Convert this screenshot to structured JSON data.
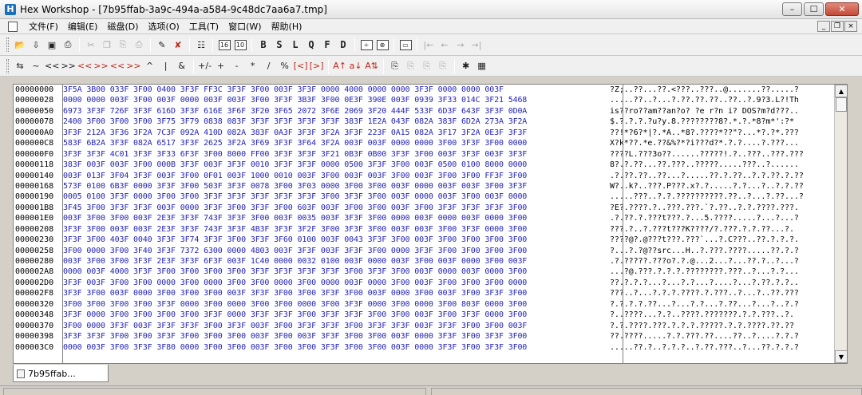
{
  "window": {
    "title": "Hex Workshop - [7b95ffab-3a9c-494a-a584-9c48dc7aa6a7.tmp]",
    "app_icon": "H",
    "min_label": "–",
    "max_label": "☐",
    "close_label": "✕"
  },
  "menubar": {
    "items": [
      "文件(F)",
      "编辑(E)",
      "磁盘(D)",
      "选项(O)",
      "工具(T)",
      "窗口(W)",
      "帮助(H)"
    ],
    "mdi_min": "_",
    "mdi_restore": "❐",
    "mdi_close": "×"
  },
  "toolbar1": {
    "open": "📂",
    "save_all": "⇩",
    "save": "▣",
    "print": "⎙",
    "cut": "✂",
    "copy": "❐",
    "paste": "⎘",
    "paste_special": "⎙",
    "find": "✎",
    "replace": "✘",
    "properties": "☷",
    "cols_16": "16",
    "cols_10": "10",
    "b_label": "B",
    "s_label": "S",
    "l_label": "L",
    "q_label": "Q",
    "f_label": "F",
    "d_label": "D",
    "calc": "÷",
    "bookmark": "⊕",
    "window": "▭",
    "nav_first": "|←",
    "nav_prev": "←",
    "nav_next": "→",
    "nav_last": "→|"
  },
  "toolbar2": {
    "items": [
      "⇆",
      "~",
      "<<",
      ">>",
      "<<",
      ">>",
      "<<",
      ">>",
      "^",
      "|",
      "&",
      "+/-",
      "+",
      "-",
      "*",
      "/",
      "%",
      "[<]",
      "[>]",
      "A↑",
      "a↓",
      "A⇅",
      "⎘",
      "⎘",
      "⎘",
      "⎘",
      "✱",
      "▦"
    ]
  },
  "editor": {
    "rows": [
      {
        "offset": "00000000",
        "hex": "3F5A 3B00 033F 3F00 0400 3F3F FF3C 3F3F 3F00 003F 3F3F 0000 4000 0000 0000 3F3F 0000 0000 003F",
        "text": "?Z;..??...??.<???..???..@.......??.....?"
      },
      {
        "offset": "00000028",
        "hex": "0000 0000 003F 3F00 003F 0000 003F 003F 3F00 3F3F 3B3F 3F00 0E3F 390E 003F 0939 3F33 014C 3F21 5468",
        "text": ".....??..?...?.??.??.??..??..?.9?3.L?!Th"
      },
      {
        "offset": "00000050",
        "hex": "6973 3F3F 726F 3F3F 616D 3F3F 616E 3F6F 3F20 3F65 2072 3F6E 2069 3F20 444F 533F 6D3F 643F 3F3F 0D0A",
        "text": "is??ro??am??an?o? ?e r?n i? DOS?m?d???.."
      },
      {
        "offset": "00000078",
        "hex": "2400 3F00 3F00 3F00 3F75 3F79 0838 083F 3F3F 3F3F 3F3F 3F3F 383F 1E2A 043F 082A 383F 6D2A 273A 3F2A",
        "text": "$.?.?.?.?u?y.8.????????8?.*.?.*8?m*':?*"
      },
      {
        "offset": "000000A0",
        "hex": "3F3F 212A 3F36 3F2A 7C3F 092A 410D 082A 383F 0A3F 3F3F 3F2A 3F3F 223F 0A15 082A 3F17 3F2A 0E3F 3F3F",
        "text": "??!*?6?*|?.*A..*8?.????*??\"?...*?.?*.???"
      },
      {
        "offset": "000000C8",
        "hex": "583F 6B2A 3F3F 082A 6517 3F3F 2625 3F2A 3F69 3F3F 3F64 3F2A 003F 003F 0000 0000 3F00 3F3F 3F00 0000",
        "text": "X?k*??.*e.??&%?*?i???d?*.?.?....?.???..."
      },
      {
        "offset": "000000F0",
        "hex": "3F3F 3F3F 4C01 3F3F 3F33 6F3F 3F00 8000 FF00 3F3F 3F3F 3F21 0B3F 0B00 3F3F 3F00 003F 3F3F 003F 3F3F",
        "text": "????L.???3o??......?????!.?..???..???.???"
      },
      {
        "offset": "00000118",
        "hex": "383F 003F 003F 3F00 000B 3F3F 003F 3F3F 0010 3F3F 3F3F 0000 0500 3F3F 3F00 003F 0500 0100 8000 0000",
        "text": "8?.?.??...??.???..?????.....???..?......"
      },
      {
        "offset": "00000140",
        "hex": "003F 013F 3F04 3F3F 003F 3F00 0F01 003F 1000 0010 003F 3F00 003F 003F 3F00 003F 3F00 3F00 FF3F 3F00",
        "text": ".?.??.??..??...?.....??.?.??..?.?.??.?.??"
      },
      {
        "offset": "00000168",
        "hex": "573F 0100 6B3F 0000 3F3F 3F00 503F 3F3F 0078 3F00 3F03 0000 3F00 3F00 003F 0000 003F 003F 3F00 3F3F",
        "text": "W?..k?..???.P???.x?.?.....?.?...?..?.?.??"
      },
      {
        "offset": "00000190",
        "hex": "0005 0100 3F3F 0000 3F00 3F00 3F3F 3F3F 3F3F 3F3F 3F3F 3F00 3F3F 3F00 003F 0000 003F 3F00 003F 0000",
        "text": ".....???..?.?.??????????.??..?...?.??...?"
      },
      {
        "offset": "000001B8",
        "hex": "3F45 3F00 3F3F 3F3F 003F 0000 3F3F 3F00 3F3F 3F00 603F 003F 3F00 3F00 003F 3F00 3F3F 3F3F 3F3F 3F00",
        "text": "?E?.????.?..???.???.`?.??..?.?.????.???."
      },
      {
        "offset": "000001E0",
        "hex": "003F 3F00 3F00 003F 2E3F 3F3F 743F 3F3F 3F00 003F 0035 003F 3F3F 3F00 0000 003F 0000 003F 0000 3F00",
        "text": ".?.??.?.???t???.?...5.????.....?...?...?"
      },
      {
        "offset": "00000208",
        "hex": "3F3F 3F00 003F 003F 2E3F 3F3F 743F 3F3F 4B3F 3F3F 3F2F 3F00 3F3F 3F00 003F 003F 3F00 3F3F 0000 3F00",
        "text": "???.?..?.???t???K????/?.???.?.?.??...?."
      },
      {
        "offset": "00000230",
        "hex": "3F3F 3F00 403F 0040 3F3F 3F74 3F3F 3F00 3F3F 3F60 0100 003F 0043 3F3F 3F00 003F 3F00 3F00 3F00 3F00",
        "text": "????@?.@???t???.???`...?.C???..??.?.?.?."
      },
      {
        "offset": "00000258",
        "hex": "3F00 0000 3F00 3F40 3F3F 7372 6300 0000 4803 003F 3F3F 003F 3F3F 3F00 0000 3F3F 3F00 3F00 3F00 3F00",
        "text": "?...?.?@??src...H..?.???.????.....??.?.?"
      },
      {
        "offset": "00000280",
        "hex": "003F 3F00 3F00 3F3F 2E3F 3F3F 6F3F 003F 1C40 0000 0032 0100 003F 0000 003F 3F00 003F 0000 3F00 003F",
        "text": ".?.?????.???o?.?.@...2...?...??.?..?...?"
      },
      {
        "offset": "000002A8",
        "hex": "0000 003F 4000 3F3F 3F00 3F00 3F00 3F00 3F3F 3F3F 3F3F 3F3F 3F00 3F3F 3F00 003F 0000 003F 0000 3F00",
        "text": "...?@.???.?.?.?.????????.???..?...?.?..."
      },
      {
        "offset": "000002D0",
        "hex": "3F3F 003F 3F00 3F00 0000 3F00 0000 3F00 3F00 0000 3F00 0000 003F 0000 3F00 003F 3F00 3F00 3F00 0000",
        "text": "??.?.?.?...?...?.?...?....?...?.??.?.?.."
      },
      {
        "offset": "000002F8",
        "hex": "3F3F 3F00 003F 0000 3F00 3F00 3F00 003F 3F3F 3F00 3F00 3F3F 3F00 003F 0000 3F00 003F 3F00 3F3F 3F00",
        "text": "???..?...?.?.?.????.?.???..?...?..??.???"
      },
      {
        "offset": "00000320",
        "hex": "3F00 3F00 3F00 3F00 3F3F 0000 3F00 0000 3F00 3F00 0000 3F00 3F3F 0000 3F00 0000 3F00 803F 0000 3F00",
        "text": "?.?.?.?.??...?...?.?...?.??...?...?..?.?"
      },
      {
        "offset": "00000348",
        "hex": "3F3F 0000 3F00 3F00 3F00 3F00 3F3F 0000 3F3F 3F3F 3F00 3F3F 3F3F 3F00 3F00 003F 3F00 3F3F 0000 3F00",
        "text": "?..????...?.?..????.???????.?.?.???..?."
      },
      {
        "offset": "00000370",
        "hex": "3F00 0000 3F3F 003F 3F3F 3F3F 3F00 3F3F 003F 3F00 3F3F 3F3F 3F00 3F3F 3F3F 003F 3F3F 3F00 3F00 003F",
        "text": "?.?.????.???.?.?.?.?????.?.?.????.??.??"
      },
      {
        "offset": "00000398",
        "hex": "3F3F 3F3F 3F00 3F00 3F3F 3F00 3F00 3F00 003F 3F00 003F 3F3F 3F00 3F00 003F 0000 3F3F 3F00 3F3F 3F00",
        "text": "??.????.....?.?.???.??....??..?....?.?.?"
      },
      {
        "offset": "000003C0",
        "hex": "0000 003F 3F00 3F3F 3F80 0000 3F00 3F00 003F 3F00 3F00 3F3F 3F00 3F00 003F 0000 3F3F 3F00 3F3F 3F00",
        "text": ".....??.?..?.?.?..?.??.???..?...??.?.?.?"
      }
    ]
  },
  "tabs": {
    "active_label": "7b95ffab..."
  }
}
